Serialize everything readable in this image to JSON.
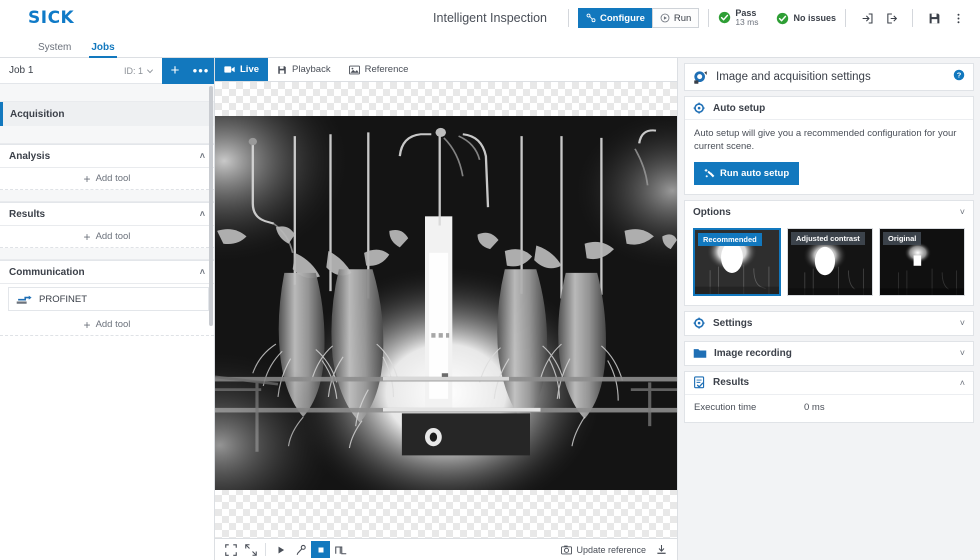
{
  "header": {
    "logo": "SICK",
    "app_title": "Intelligent Inspection",
    "mode_buttons": [
      {
        "label": "Configure",
        "icon": "configure-icon",
        "active": true
      },
      {
        "label": "Run",
        "icon": "play-icon",
        "active": false
      }
    ],
    "status": {
      "pass_label": "Pass",
      "pass_time": "13 ms",
      "issues_label": "No issues",
      "ok_color": "#2e9e35"
    },
    "icons": [
      "login-icon",
      "logout-icon",
      "save-icon",
      "overflow-menu-icon"
    ],
    "accent_color": "#1278be",
    "logo_color": "#0f7ac7"
  },
  "tabs": [
    {
      "label": "System",
      "active": false
    },
    {
      "label": "Jobs",
      "active": true
    }
  ],
  "sidebar": {
    "job": {
      "name": "Job 1",
      "id_label": "ID: 1",
      "add_label": "+",
      "more_label": "•••"
    },
    "acquisition": {
      "label": "Acquisition"
    },
    "sections": [
      {
        "label": "Analysis",
        "chevron": "˄",
        "add_tool": "Add tool",
        "tools": []
      },
      {
        "label": "Results",
        "chevron": "˄",
        "add_tool": "Add tool",
        "tools": []
      },
      {
        "label": "Communication",
        "chevron": "˄",
        "add_tool": "Add tool",
        "tools": [
          {
            "label": "PROFINET",
            "icon": "profinet-icon"
          }
        ]
      }
    ]
  },
  "viewer": {
    "tabs": [
      {
        "label": "Live",
        "icon": "camera-icon",
        "active": true
      },
      {
        "label": "Playback",
        "icon": "floppy-icon",
        "active": false
      },
      {
        "label": "Reference",
        "icon": "image-icon",
        "active": false
      }
    ],
    "toolbar": {
      "left_icons": [
        "fit-to-screen-icon",
        "actual-size-icon",
        "play-icon",
        "single-shot-icon",
        "stop-icon",
        "trigger-icon"
      ],
      "update_reference_label": "Update reference",
      "update_reference_icon": "camera-icon",
      "download_icon": "download-icon"
    },
    "image_alt": "Live grayscale image of poultry processing line shackles"
  },
  "right_panel": {
    "title": "Image and acquisition settings",
    "title_icon": "camera-settings-icon",
    "help_icon": "help-icon",
    "auto_setup": {
      "heading": "Auto setup",
      "icon": "auto-setup-icon",
      "description": "Auto setup will give you a recommended configuration for your current scene.",
      "button_label": "Run auto setup",
      "button_icon": "magic-wand-icon"
    },
    "options": {
      "heading": "Options",
      "chevron": "˅",
      "thumbnails": [
        {
          "label": "Recommended",
          "selected": true
        },
        {
          "label": "Adjusted contrast",
          "selected": false
        },
        {
          "label": "Original",
          "selected": false
        }
      ]
    },
    "settings": {
      "heading": "Settings",
      "icon": "settings-icon",
      "chevron": "˅"
    },
    "image_recording": {
      "heading": "Image recording",
      "icon": "folder-icon",
      "chevron": "˅"
    },
    "results": {
      "heading": "Results",
      "icon": "results-icon",
      "chevron": "˄",
      "rows": [
        {
          "label": "Execution time",
          "value": "0 ms"
        }
      ]
    }
  }
}
